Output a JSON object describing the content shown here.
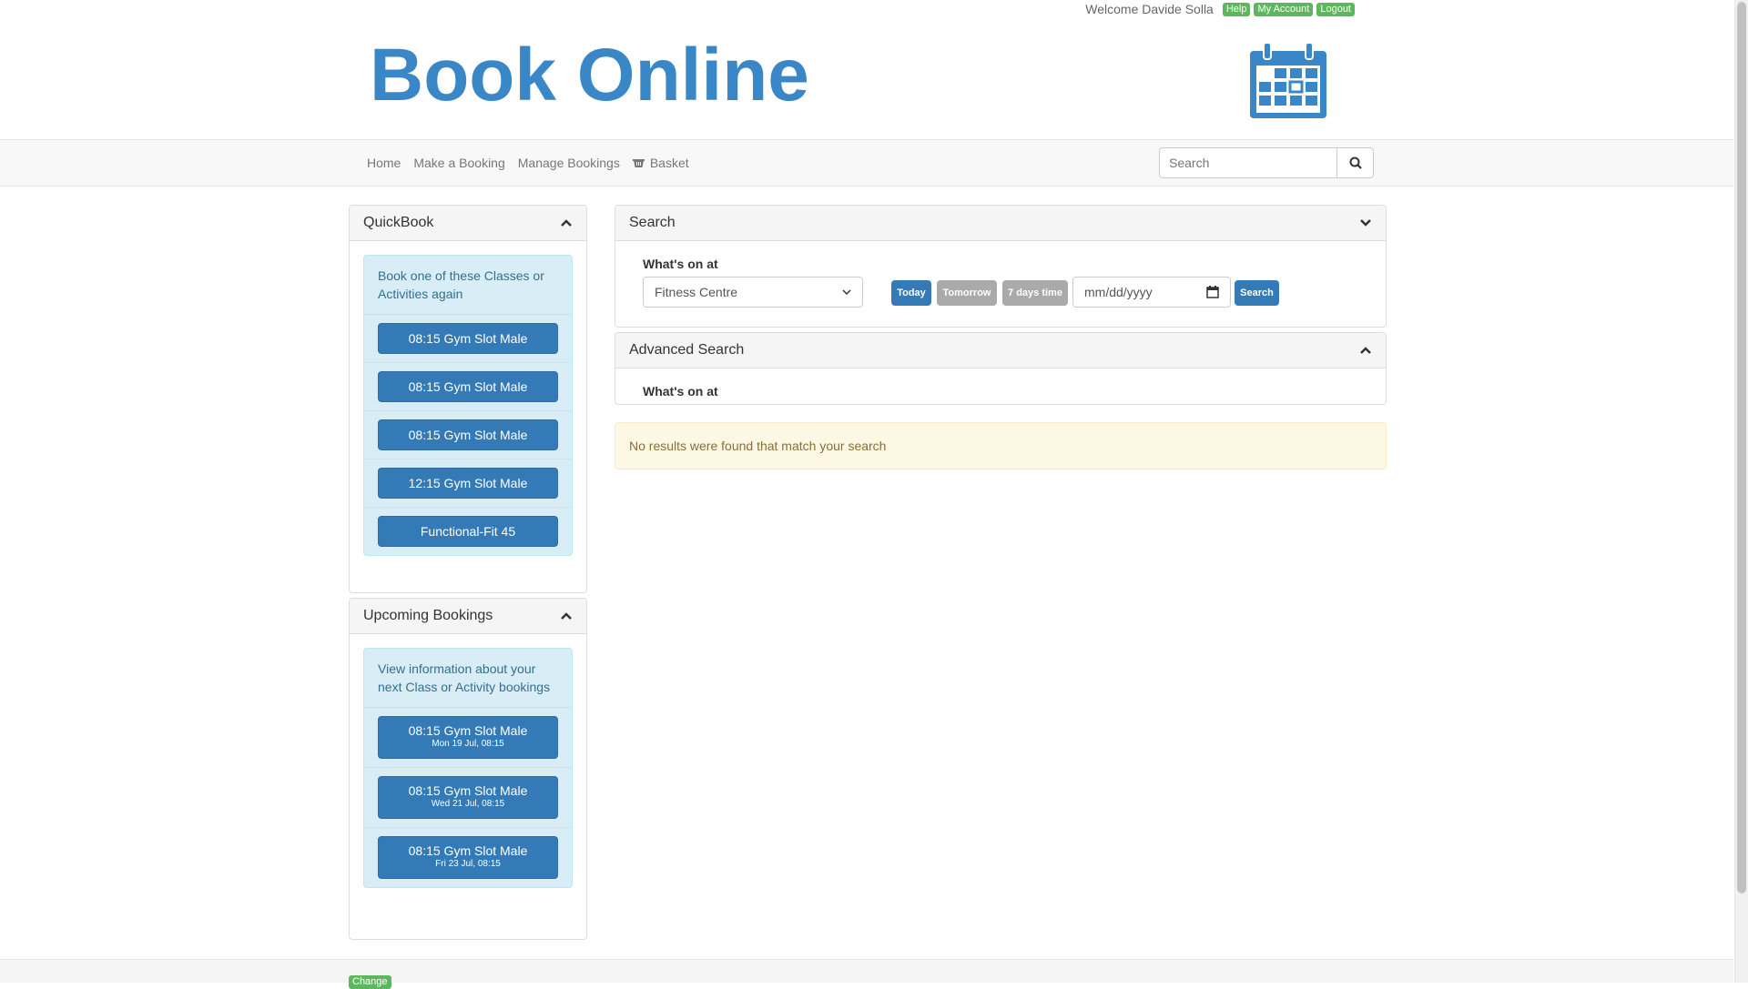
{
  "topbar": {
    "welcome": "Welcome Davide Solla",
    "links": [
      "Help",
      "My Account",
      "Logout"
    ]
  },
  "header": {
    "logo_text": "Book Online",
    "brand_color": "#3a87c8",
    "icon": "calendar-icon"
  },
  "nav": {
    "items": [
      "Home",
      "Make a Booking",
      "Manage Bookings",
      "Basket"
    ],
    "basket_icon": "basket-icon",
    "search_placeholder": "Search"
  },
  "quickbook": {
    "title": "QuickBook",
    "intro": "Book one of these Classes or Activities again",
    "buttons": [
      "08:15 Gym Slot Male",
      "08:15 Gym Slot Male",
      "08:15 Gym Slot Male",
      "12:15 Gym Slot Male",
      "Functional-Fit 45"
    ]
  },
  "upcoming": {
    "title": "Upcoming Bookings",
    "intro": "View information about your next Class or Activity bookings",
    "bookings": [
      {
        "name": "08:15 Gym Slot Male",
        "when": "Mon 19 Jul, 08:15"
      },
      {
        "name": "08:15 Gym Slot Male",
        "when": "Wed 21 Jul, 08:15"
      },
      {
        "name": "08:15 Gym Slot Male",
        "when": "Fri 23 Jul, 08:15"
      }
    ]
  },
  "search_panel": {
    "title": "Search",
    "whats_on_label": "What's on at",
    "location_value": "Fitness Centre",
    "today": "Today",
    "tomorrow": "Tomorrow",
    "seven_days": "7 days time",
    "date_placeholder": "mm/dd/yyyy",
    "search_button": "Search"
  },
  "advanced_search": {
    "title": "Advanced Search",
    "whats_on_label": "What's on at"
  },
  "results": {
    "message": "No results were found that match your search"
  },
  "footer": {
    "change": "Change"
  },
  "colors": {
    "primary": "#337ab7",
    "success": "#5cb85c",
    "info_bg": "#d9edf7",
    "warning_bg": "#fcf8e3"
  }
}
